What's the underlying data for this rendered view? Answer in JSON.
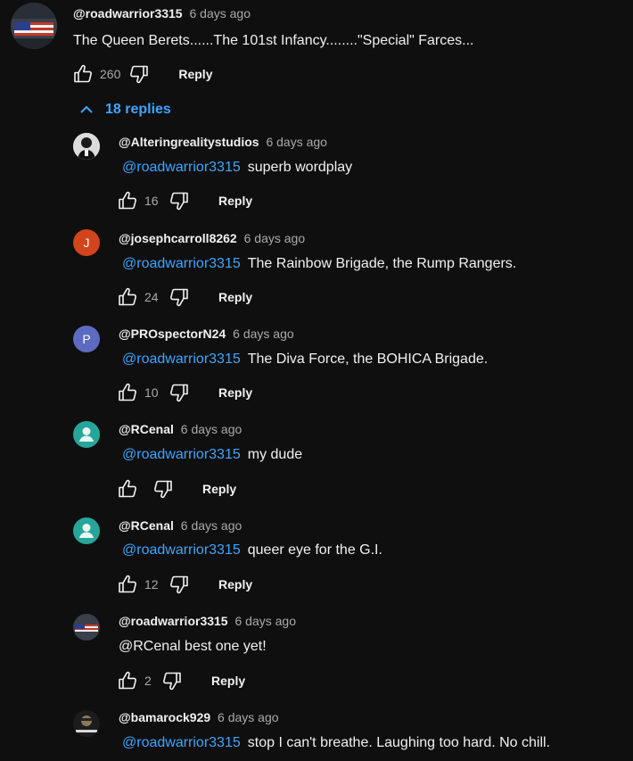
{
  "colors": {
    "background": "#0f0f0f",
    "text": "#f1f1f1",
    "muted": "#aaaaaa",
    "link": "#3ea6ff",
    "avatar_j": "#d1441c",
    "avatar_p": "#5c6bc0",
    "avatar_r": "#26a69a"
  },
  "icons": {
    "like": "thumb-up-icon",
    "dislike": "thumb-down-icon",
    "chevron": "chevron-up-icon",
    "avatar_default": "person-icon"
  },
  "top_comment": {
    "author": "@roadwarrior3315",
    "time": "6 days ago",
    "text": "The Queen Berets......The 101st Infancy........\"Special\" Farces...",
    "likes": "260",
    "reply_label": "Reply"
  },
  "replies_toggle": {
    "label": "18 replies"
  },
  "replies": [
    {
      "author": "@Alteringrealitystudios",
      "time": "6 days ago",
      "mention": "@roadwarrior3315",
      "text": "superb wordplay",
      "likes": "16",
      "reply_label": "Reply"
    },
    {
      "author": "@josephcarroll8262",
      "time": "6 days ago",
      "avatar_letter": "J",
      "mention": "@roadwarrior3315",
      "text": "The Rainbow Brigade, the Rump Rangers.",
      "likes": "24",
      "reply_label": "Reply"
    },
    {
      "author": "@PROspectorN24",
      "time": "6 days ago",
      "avatar_letter": "P",
      "mention": "@roadwarrior3315",
      "text": "The Diva Force, the BOHICA Brigade.",
      "likes": "10",
      "reply_label": "Reply"
    },
    {
      "author": "@RCenal",
      "time": "6 days ago",
      "mention": "@roadwarrior3315",
      "text": "my dude",
      "reply_label": "Reply"
    },
    {
      "author": "@RCenal",
      "time": "6 days ago",
      "mention": "@roadwarrior3315",
      "text": "queer eye for the G.I.",
      "likes": "12",
      "reply_label": "Reply"
    },
    {
      "author": "@roadwarrior3315",
      "time": "6 days ago",
      "text": "@RCenal  best one yet!",
      "likes": "2",
      "reply_label": "Reply"
    },
    {
      "author": "@bamarock929",
      "time": "6 days ago",
      "mention": "@roadwarrior3315",
      "text": "stop I can't breathe. Laughing too hard. No chill."
    }
  ]
}
